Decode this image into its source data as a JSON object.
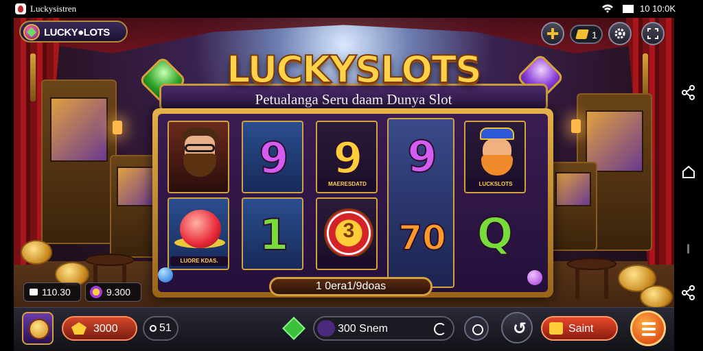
{
  "statusbar": {
    "app_title": "Luckysistren",
    "time": "10 10:0K"
  },
  "game": {
    "logo_text": "LUCKY●LOTS",
    "title": "LUCKYSLOTS",
    "subtitle": "Petualanga Seru daam Dunya Slot",
    "ticket_count": "1",
    "reels": [
      {
        "top": {
          "kind": "character",
          "label": ""
        },
        "bottom": {
          "kind": "ball",
          "label": "LUORE KDAS."
        }
      },
      {
        "top": {
          "kind": "number",
          "value": "9",
          "color": "purple"
        },
        "bottom": {
          "kind": "number",
          "value": "1",
          "color": "green"
        }
      },
      {
        "top": {
          "kind": "number",
          "value": "9",
          "color": "gold",
          "label": "MAERESDATD"
        },
        "bottom": {
          "kind": "chip",
          "value": "3",
          "label": ""
        }
      },
      {
        "top": {
          "kind": "number",
          "value": "9",
          "color": "purple"
        },
        "bottom": {
          "kind": "number",
          "value": "70",
          "color": "orange"
        }
      },
      {
        "top": {
          "kind": "jester",
          "label": "LUCKSLOTS"
        },
        "bottom": {
          "kind": "number",
          "value": "Q",
          "color": "green"
        }
      }
    ],
    "payline_text": "1 0era1/9doas",
    "left_readout_1": "110.30",
    "left_readout_2": "9.300"
  },
  "bottombar": {
    "bet_value": "3000",
    "small_value": "51",
    "spin_text": "300 Snem",
    "start_label": "Saint"
  },
  "icons": [
    "wifi-icon",
    "battery-icon",
    "plus-icon",
    "ticket-icon",
    "gear-icon",
    "fullscreen-icon",
    "share-icon",
    "home-icon",
    "menu-icon"
  ]
}
